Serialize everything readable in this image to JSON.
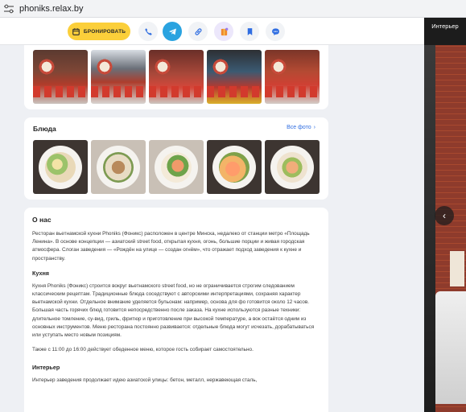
{
  "browser": {
    "url": "phoniks.relax.by"
  },
  "action_bar": {
    "book_label": "БРОНИРОВАТЬ",
    "icons": [
      "phone-icon",
      "telegram-icon",
      "link-icon",
      "gift-icon",
      "bookmark-icon",
      "chat-icon"
    ]
  },
  "media_panel": {
    "title": "Интерьер"
  },
  "dishes": {
    "title": "Блюда",
    "all_photos": "Все фото"
  },
  "about": {
    "title": "О нас",
    "intro": "Ресторан вьетнамской кухни Phoniks (Фоникс) расположен в центре Минска, недалеко от станции метро «Площадь Ленина». В основе концепции — азиатский street food, открытая кухня, огонь, большие порции и живая городская атмосфера. Слоган заведения — «Рождён на улице — создан огнём», что отражает подход заведения к кухне и пространству.",
    "kitchen_title": "Кухня",
    "kitchen_text": "Кухня Phoniks (Фоникс) строится вокруг вьетнамского street food, но не ограничивается строгим следованием классическим рецептам. Традиционные блюда соседствуют с авторскими интерпретациями, сохраняя характер вьетнамской кухни. Отдельное внимание уделяется бульонам: например, основа для фо готовится около 12 часов. Большая часть горячих блюд готовится непосредственно после заказа. На кухне используются разные техники: длительное томление, су-вид, гриль, фритюр и приготовление при высокой температуре, а вок остаётся одним из основных инструментов. Меню ресторана постоянно развивается: отдельные блюда могут исчезать, дорабатываться или уступать место новым позициям.",
    "lunch_text": "Также с 11:00 до 16:00 действует обеденное меню, которое гость собирает самостоятельно.",
    "interior_title": "Интерьер",
    "interior_text": "Интерьер заведения продолжает идею азиатской улицы: бетон, металл, нержавеющая сталь,"
  }
}
